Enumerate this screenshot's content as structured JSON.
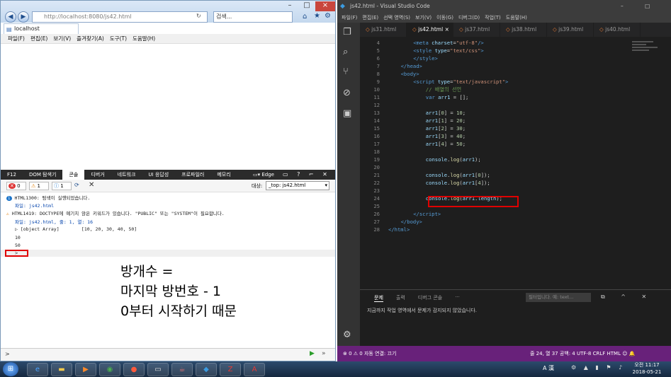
{
  "ie": {
    "url": "http://localhost:8080/js42.html",
    "search_placeholder": "검색...",
    "tab_title": "localhost",
    "menu": [
      "파일(F)",
      "편집(E)",
      "보기(V)",
      "즐겨찾기(A)",
      "도구(T)",
      "도움말(H)"
    ],
    "devtools": {
      "tabs": [
        "F12",
        "DOM 탐색기",
        "콘솔",
        "디버거",
        "네트워크",
        "UI 응답성",
        "프로파일러",
        "메모리"
      ],
      "emulation": "Edge",
      "error_count": "0",
      "warn_count": "1",
      "info_count": "1",
      "target_label": "대상:",
      "target_value": "_top: js42.html",
      "console": [
        {
          "icon": "info",
          "text": "HTML1300: 탐색이 실행되었습니다."
        },
        {
          "icon": "",
          "text": "파일: js42.html"
        },
        {
          "icon": "warn",
          "text": "HTML1419: DOCTYPE에 예기치 않은 키워드가 있습니다. \"PUBLIC\" 또는 \"SYSTEM\"이 필요합니다."
        },
        {
          "icon": "",
          "text": "파일: js42.html, 줄: 1, 열: 16"
        },
        {
          "icon": "",
          "text": "▷ [object Array]        [10, 20, 30, 40, 50]"
        },
        {
          "icon": "",
          "text": "10"
        },
        {
          "icon": "",
          "text": "50"
        }
      ],
      "prompt": ">"
    }
  },
  "note_lines": [
    "방개수 =",
    "마지막 방번호 - 1",
    "0부터 시작하기 때문"
  ],
  "vscode": {
    "title": "js42.html - Visual Studio Code",
    "menu": [
      "파일(F)",
      "편집(E)",
      "선택 영역(S)",
      "보기(V)",
      "이동(G)",
      "디버그(D)",
      "작업(T)",
      "도움말(H)"
    ],
    "tabs": [
      "js31.html",
      "js42.html",
      "js37.html",
      "js38.html",
      "js39.html",
      "js40.html"
    ],
    "active_tab": 1,
    "panel_tabs": [
      "문제",
      "출력",
      "디버그 콘솔",
      "···"
    ],
    "panel_filter": "필터입니다. 예: text...",
    "panel_message": "지금까지 작업 영역에서 문제가 감지되지 않았습니다.",
    "status_left": "⊗ 0 ⚠ 0   자동 연결: 끄기",
    "status_right": "줄 24, 열 37   공백: 4   UTF-8   CRLF   HTML   ☺  🔔",
    "highlight_color": "#e00000"
  },
  "code_lines": [
    {
      "n": "4",
      "html": "<span class='tag'>&lt;meta</span> <span class='att'>charset</span>=<span class='str'>\"utf-8\"</span><span class='tag'>/&gt;</span>",
      "indent": 8
    },
    {
      "n": "5",
      "html": "<span class='tag'>&lt;style</span> <span class='att'>type</span>=<span class='str'>\"text/css\"</span><span class='tag'>&gt;</span>",
      "indent": 8
    },
    {
      "n": "6",
      "html": "<span class='tag'>&lt;/style&gt;</span>",
      "indent": 8
    },
    {
      "n": "7",
      "html": "<span class='tag'>&lt;/head&gt;</span>",
      "indent": 4
    },
    {
      "n": "8",
      "html": "<span class='tag'>&lt;body&gt;</span>",
      "indent": 4
    },
    {
      "n": "9",
      "html": "<span class='tag'>&lt;script</span> <span class='att'>type</span>=<span class='str'>\"text/javascript\"</span><span class='tag'>&gt;</span>",
      "indent": 8
    },
    {
      "n": "10",
      "html": "<span class='cmt'>// 배열의 선언</span>",
      "indent": 12
    },
    {
      "n": "11",
      "html": "<span class='kw'>var</span> <span class='att'>arr1</span> = [];",
      "indent": 12
    },
    {
      "n": "12",
      "html": "",
      "indent": 12
    },
    {
      "n": "13",
      "html": "<span class='att'>arr1</span>[<span class='num'>0</span>] = <span class='num'>10</span>;",
      "indent": 12
    },
    {
      "n": "14",
      "html": "<span class='att'>arr1</span>[<span class='num'>1</span>] = <span class='num'>20</span>;",
      "indent": 12
    },
    {
      "n": "15",
      "html": "<span class='att'>arr1</span>[<span class='num'>2</span>] = <span class='num'>30</span>;",
      "indent": 12
    },
    {
      "n": "16",
      "html": "<span class='att'>arr1</span>[<span class='num'>3</span>] = <span class='num'>40</span>;",
      "indent": 12
    },
    {
      "n": "17",
      "html": "<span class='att'>arr1</span>[<span class='num'>4</span>] = <span class='num'>50</span>;",
      "indent": 12
    },
    {
      "n": "18",
      "html": "",
      "indent": 12
    },
    {
      "n": "19",
      "html": "<span class='att'>console</span>.<span class='fn'>log</span>(<span class='att'>arr1</span>);",
      "indent": 12
    },
    {
      "n": "20",
      "html": "",
      "indent": 12
    },
    {
      "n": "21",
      "html": "<span class='att'>console</span>.<span class='fn'>log</span>(<span class='att'>arr1</span>[<span class='num'>0</span>]);",
      "indent": 12
    },
    {
      "n": "22",
      "html": "<span class='att'>console</span>.<span class='fn'>log</span>(<span class='att'>arr1</span>[<span class='num'>4</span>]);",
      "indent": 12
    },
    {
      "n": "23",
      "html": "",
      "indent": 12
    },
    {
      "n": "24",
      "html": "<span class='att'>console</span>.<span class='fn'>log</span>(<span class='att'>arr1</span>.<span class='att'>length</span>);",
      "indent": 12
    },
    {
      "n": "25",
      "html": "",
      "indent": 12
    },
    {
      "n": "26",
      "html": "<span class='tag'>&lt;/script&gt;</span>",
      "indent": 8
    },
    {
      "n": "27",
      "html": "<span class='tag'>&lt;/body&gt;</span>",
      "indent": 4
    },
    {
      "n": "28",
      "html": "<span class='tag'>&lt;/html&gt;</span>",
      "indent": 0
    }
  ],
  "taskbar": {
    "apps": [
      "start",
      "ie",
      "explorer",
      "media",
      "chrome",
      "bandicam",
      "cmd",
      "java",
      "vscode",
      "filezilla",
      "pdf"
    ],
    "ime": "A 漢",
    "time": "오전 11:17",
    "date": "2018-05-21"
  }
}
